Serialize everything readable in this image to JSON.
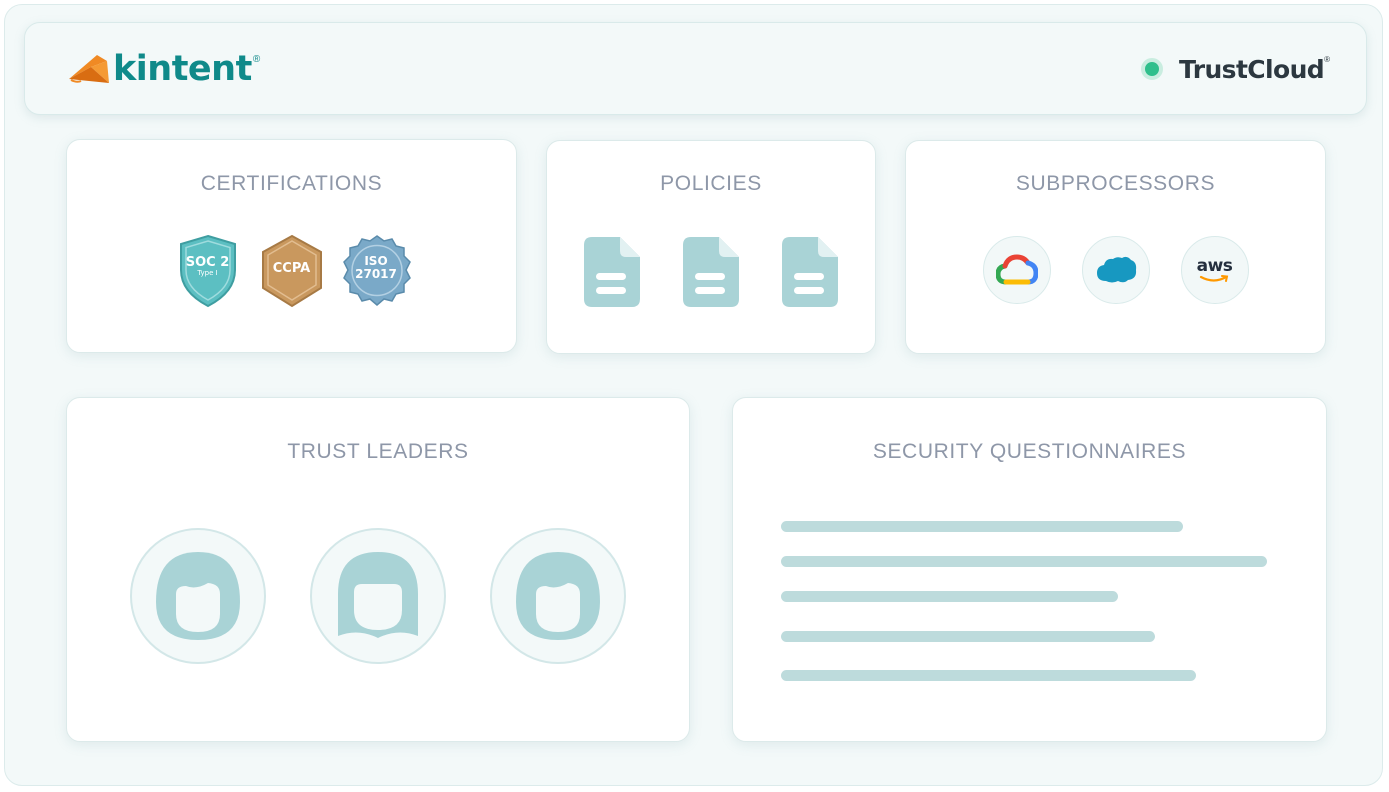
{
  "header": {
    "brand": "kintent",
    "brand_reg": "®",
    "product": "TrustCloud",
    "product_reg": "®",
    "status_color": "#2fbf8c"
  },
  "certifications": {
    "title": "CERTIFICATIONS",
    "badges": [
      {
        "line1": "SOC 2",
        "line2": "Type I",
        "color": "#5cbfc2",
        "shape": "shield"
      },
      {
        "line1": "CCPA",
        "line2": "",
        "color": "#c9985e",
        "shape": "hexagon"
      },
      {
        "line1": "ISO",
        "line2": "27017",
        "color": "#7aa9c8",
        "shape": "seal"
      }
    ]
  },
  "policies": {
    "title": "POLICIES",
    "documents": [
      "document-icon",
      "document-icon",
      "document-icon"
    ],
    "icon_color": "#a9d3d6"
  },
  "subprocessors": {
    "title": "SUBPROCESSORS",
    "vendors": [
      {
        "icon": "google-cloud-icon"
      },
      {
        "icon": "salesforce-icon"
      },
      {
        "icon": "aws-icon",
        "label": "aws"
      }
    ]
  },
  "trust_leaders": {
    "title": "TRUST LEADERS",
    "avatars": [
      "person-icon",
      "person-icon",
      "person-icon"
    ]
  },
  "security_questionnaires": {
    "title": "SECURITY QUESTIONNAIRES"
  },
  "colors": {
    "accent": "#0f8a8a",
    "logo_orange": "#f08a24",
    "title_gray": "#8e97a8",
    "placeholder_teal": "#bddbdc"
  }
}
